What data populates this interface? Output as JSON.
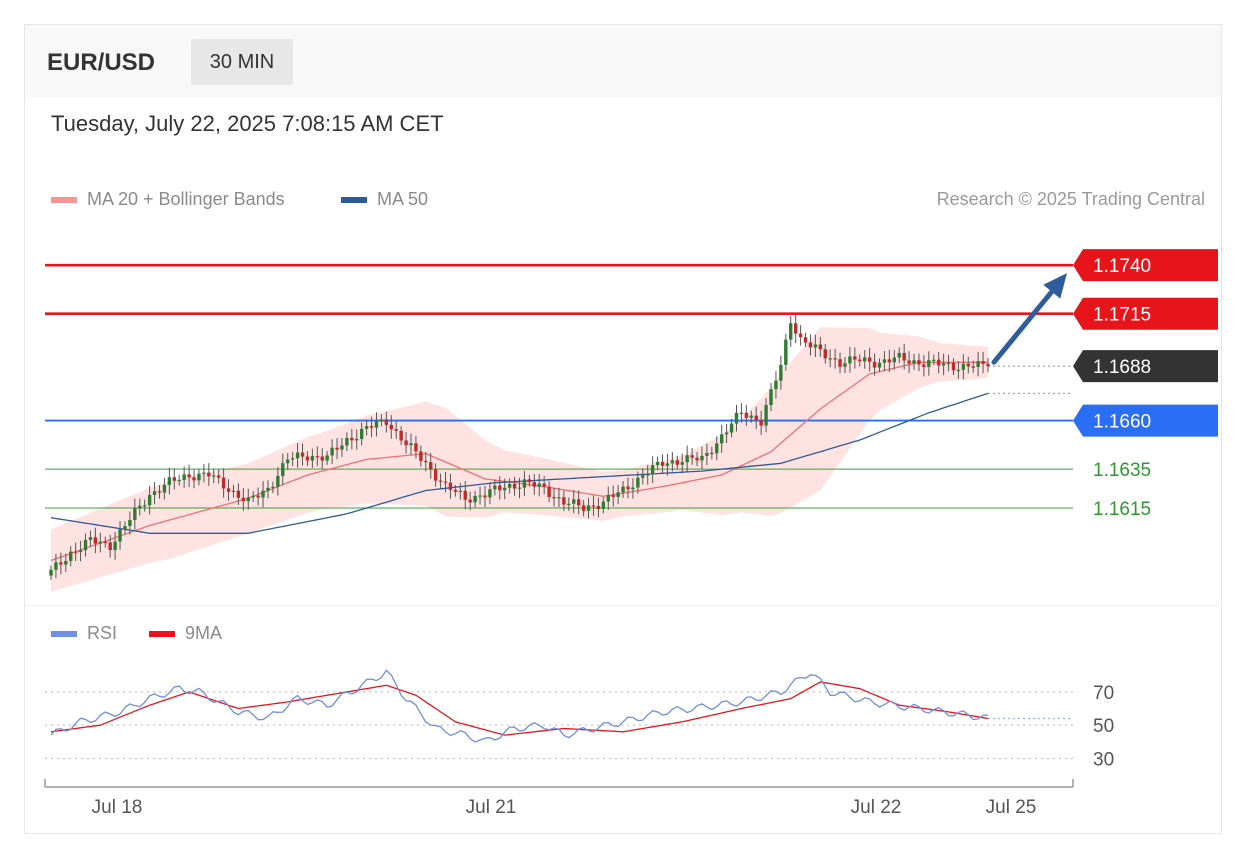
{
  "header": {
    "symbol": "EUR/USD",
    "timeframe": "30 MIN"
  },
  "datetime": "Tuesday, July 22, 2025 7:08:15 AM CET",
  "legend": {
    "ma20_label": "MA 20 + Bollinger Bands",
    "ma50_label": "MA 50",
    "copyright": "Research © 2025 Trading Central"
  },
  "colors": {
    "resistance": "#e8141c",
    "current": "#333333",
    "support_blue": "#2a6ef5",
    "support_green": "#2b9a2b",
    "ma50": "#2f5a9a",
    "ma20": "#f07070",
    "bands": "#ffdede",
    "candle_up": "#2e7d32",
    "candle_down": "#c62828",
    "rsi": "#6f8fe6",
    "rsi_ma": "#e8141c",
    "arrow": "#2f5c9c"
  },
  "chart_data": [
    {
      "type": "candlestick",
      "ylim": [
        1.158,
        1.1755
      ],
      "x_ticks": [
        "Jul 18",
        "Jul 21",
        "Jul 22",
        "Jul 25"
      ],
      "levels": [
        {
          "value": 1.174,
          "label": "1.1740",
          "kind": "resistance"
        },
        {
          "value": 1.1715,
          "label": "1.1715",
          "kind": "resistance"
        },
        {
          "value": 1.1688,
          "label": "1.1688",
          "kind": "current"
        },
        {
          "value": 1.166,
          "label": "1.1660",
          "kind": "support_blue"
        },
        {
          "value": 1.1635,
          "label": "1.1635",
          "kind": "support_green"
        },
        {
          "value": 1.1615,
          "label": "1.1615",
          "kind": "support_green"
        }
      ],
      "close_anchors": [
        [
          0,
          1.1582
        ],
        [
          4,
          1.1592
        ],
        [
          8,
          1.1598
        ],
        [
          12,
          1.1596
        ],
        [
          16,
          1.1609
        ],
        [
          20,
          1.1622
        ],
        [
          24,
          1.1628
        ],
        [
          28,
          1.1632
        ],
        [
          32,
          1.1632
        ],
        [
          36,
          1.1625
        ],
        [
          40,
          1.1618
        ],
        [
          44,
          1.1625
        ],
        [
          48,
          1.164
        ],
        [
          52,
          1.1642
        ],
        [
          56,
          1.1641
        ],
        [
          60,
          1.165
        ],
        [
          64,
          1.1656
        ],
        [
          68,
          1.166
        ],
        [
          72,
          1.1648
        ],
        [
          76,
          1.1638
        ],
        [
          80,
          1.1626
        ],
        [
          84,
          1.162
        ],
        [
          88,
          1.1622
        ],
        [
          92,
          1.1626
        ],
        [
          96,
          1.1628
        ],
        [
          100,
          1.1625
        ],
        [
          104,
          1.1618
        ],
        [
          108,
          1.1615
        ],
        [
          112,
          1.1618
        ],
        [
          116,
          1.1624
        ],
        [
          120,
          1.1632
        ],
        [
          124,
          1.1638
        ],
        [
          128,
          1.164
        ],
        [
          132,
          1.164
        ],
        [
          136,
          1.1652
        ],
        [
          140,
          1.1664
        ],
        [
          144,
          1.166
        ],
        [
          148,
          1.1688
        ],
        [
          150,
          1.1712
        ],
        [
          152,
          1.1702
        ],
        [
          156,
          1.1695
        ],
        [
          160,
          1.169
        ],
        [
          164,
          1.1691
        ],
        [
          168,
          1.169
        ],
        [
          172,
          1.1692
        ],
        [
          176,
          1.169
        ],
        [
          180,
          1.1689
        ],
        [
          184,
          1.1688
        ],
        [
          188,
          1.1688
        ],
        [
          190,
          1.1688
        ]
      ],
      "ma20_anchors": [
        [
          0,
          1.1588
        ],
        [
          20,
          1.1606
        ],
        [
          40,
          1.162
        ],
        [
          52,
          1.1632
        ],
        [
          64,
          1.164
        ],
        [
          76,
          1.1643
        ],
        [
          88,
          1.163
        ],
        [
          100,
          1.1626
        ],
        [
          112,
          1.1621
        ],
        [
          124,
          1.1626
        ],
        [
          136,
          1.1632
        ],
        [
          146,
          1.1644
        ],
        [
          156,
          1.1666
        ],
        [
          166,
          1.1684
        ],
        [
          176,
          1.169
        ],
        [
          190,
          1.169
        ]
      ],
      "ma50_anchors": [
        [
          0,
          1.161
        ],
        [
          20,
          1.1602
        ],
        [
          40,
          1.1602
        ],
        [
          60,
          1.1612
        ],
        [
          76,
          1.1624
        ],
        [
          90,
          1.1628
        ],
        [
          104,
          1.163
        ],
        [
          118,
          1.1632
        ],
        [
          132,
          1.1634
        ],
        [
          148,
          1.1638
        ],
        [
          164,
          1.165
        ],
        [
          178,
          1.1664
        ],
        [
          190,
          1.1674
        ]
      ],
      "band_width_anchors": [
        [
          0,
          0.0016
        ],
        [
          24,
          0.002
        ],
        [
          40,
          0.0018
        ],
        [
          56,
          0.002
        ],
        [
          68,
          0.0024
        ],
        [
          80,
          0.0028
        ],
        [
          92,
          0.0016
        ],
        [
          104,
          0.0014
        ],
        [
          116,
          0.0012
        ],
        [
          128,
          0.0014
        ],
        [
          140,
          0.0024
        ],
        [
          148,
          0.0036
        ],
        [
          156,
          0.0042
        ],
        [
          168,
          0.002
        ],
        [
          180,
          0.001
        ],
        [
          190,
          0.0008
        ]
      ],
      "forecast_target": 1.174
    },
    {
      "type": "line",
      "ylim": [
        20,
        85
      ],
      "y_ticks": [
        70,
        50,
        30
      ],
      "series": [
        {
          "name": "RSI",
          "anchors": [
            [
              0,
              44
            ],
            [
              6,
              52
            ],
            [
              14,
              58
            ],
            [
              20,
              66
            ],
            [
              26,
              72
            ],
            [
              30,
              70
            ],
            [
              38,
              58
            ],
            [
              44,
              54
            ],
            [
              50,
              66
            ],
            [
              56,
              62
            ],
            [
              62,
              72
            ],
            [
              68,
              82
            ],
            [
              72,
              66
            ],
            [
              78,
              48
            ],
            [
              84,
              44
            ],
            [
              88,
              40
            ],
            [
              94,
              48
            ],
            [
              100,
              50
            ],
            [
              104,
              44
            ],
            [
              110,
              48
            ],
            [
              116,
              52
            ],
            [
              124,
              58
            ],
            [
              130,
              60
            ],
            [
              140,
              64
            ],
            [
              148,
              70
            ],
            [
              154,
              82
            ],
            [
              158,
              70
            ],
            [
              166,
              64
            ],
            [
              176,
              60
            ],
            [
              186,
              56
            ],
            [
              190,
              54
            ]
          ]
        },
        {
          "name": "9MA",
          "anchors": [
            [
              0,
              46
            ],
            [
              10,
              50
            ],
            [
              20,
              62
            ],
            [
              28,
              70
            ],
            [
              38,
              60
            ],
            [
              48,
              64
            ],
            [
              60,
              70
            ],
            [
              68,
              74
            ],
            [
              74,
              68
            ],
            [
              82,
              52
            ],
            [
              92,
              44
            ],
            [
              104,
              48
            ],
            [
              116,
              46
            ],
            [
              128,
              52
            ],
            [
              140,
              60
            ],
            [
              150,
              66
            ],
            [
              156,
              76
            ],
            [
              164,
              72
            ],
            [
              172,
              62
            ],
            [
              182,
              58
            ],
            [
              190,
              54
            ]
          ]
        }
      ]
    }
  ]
}
